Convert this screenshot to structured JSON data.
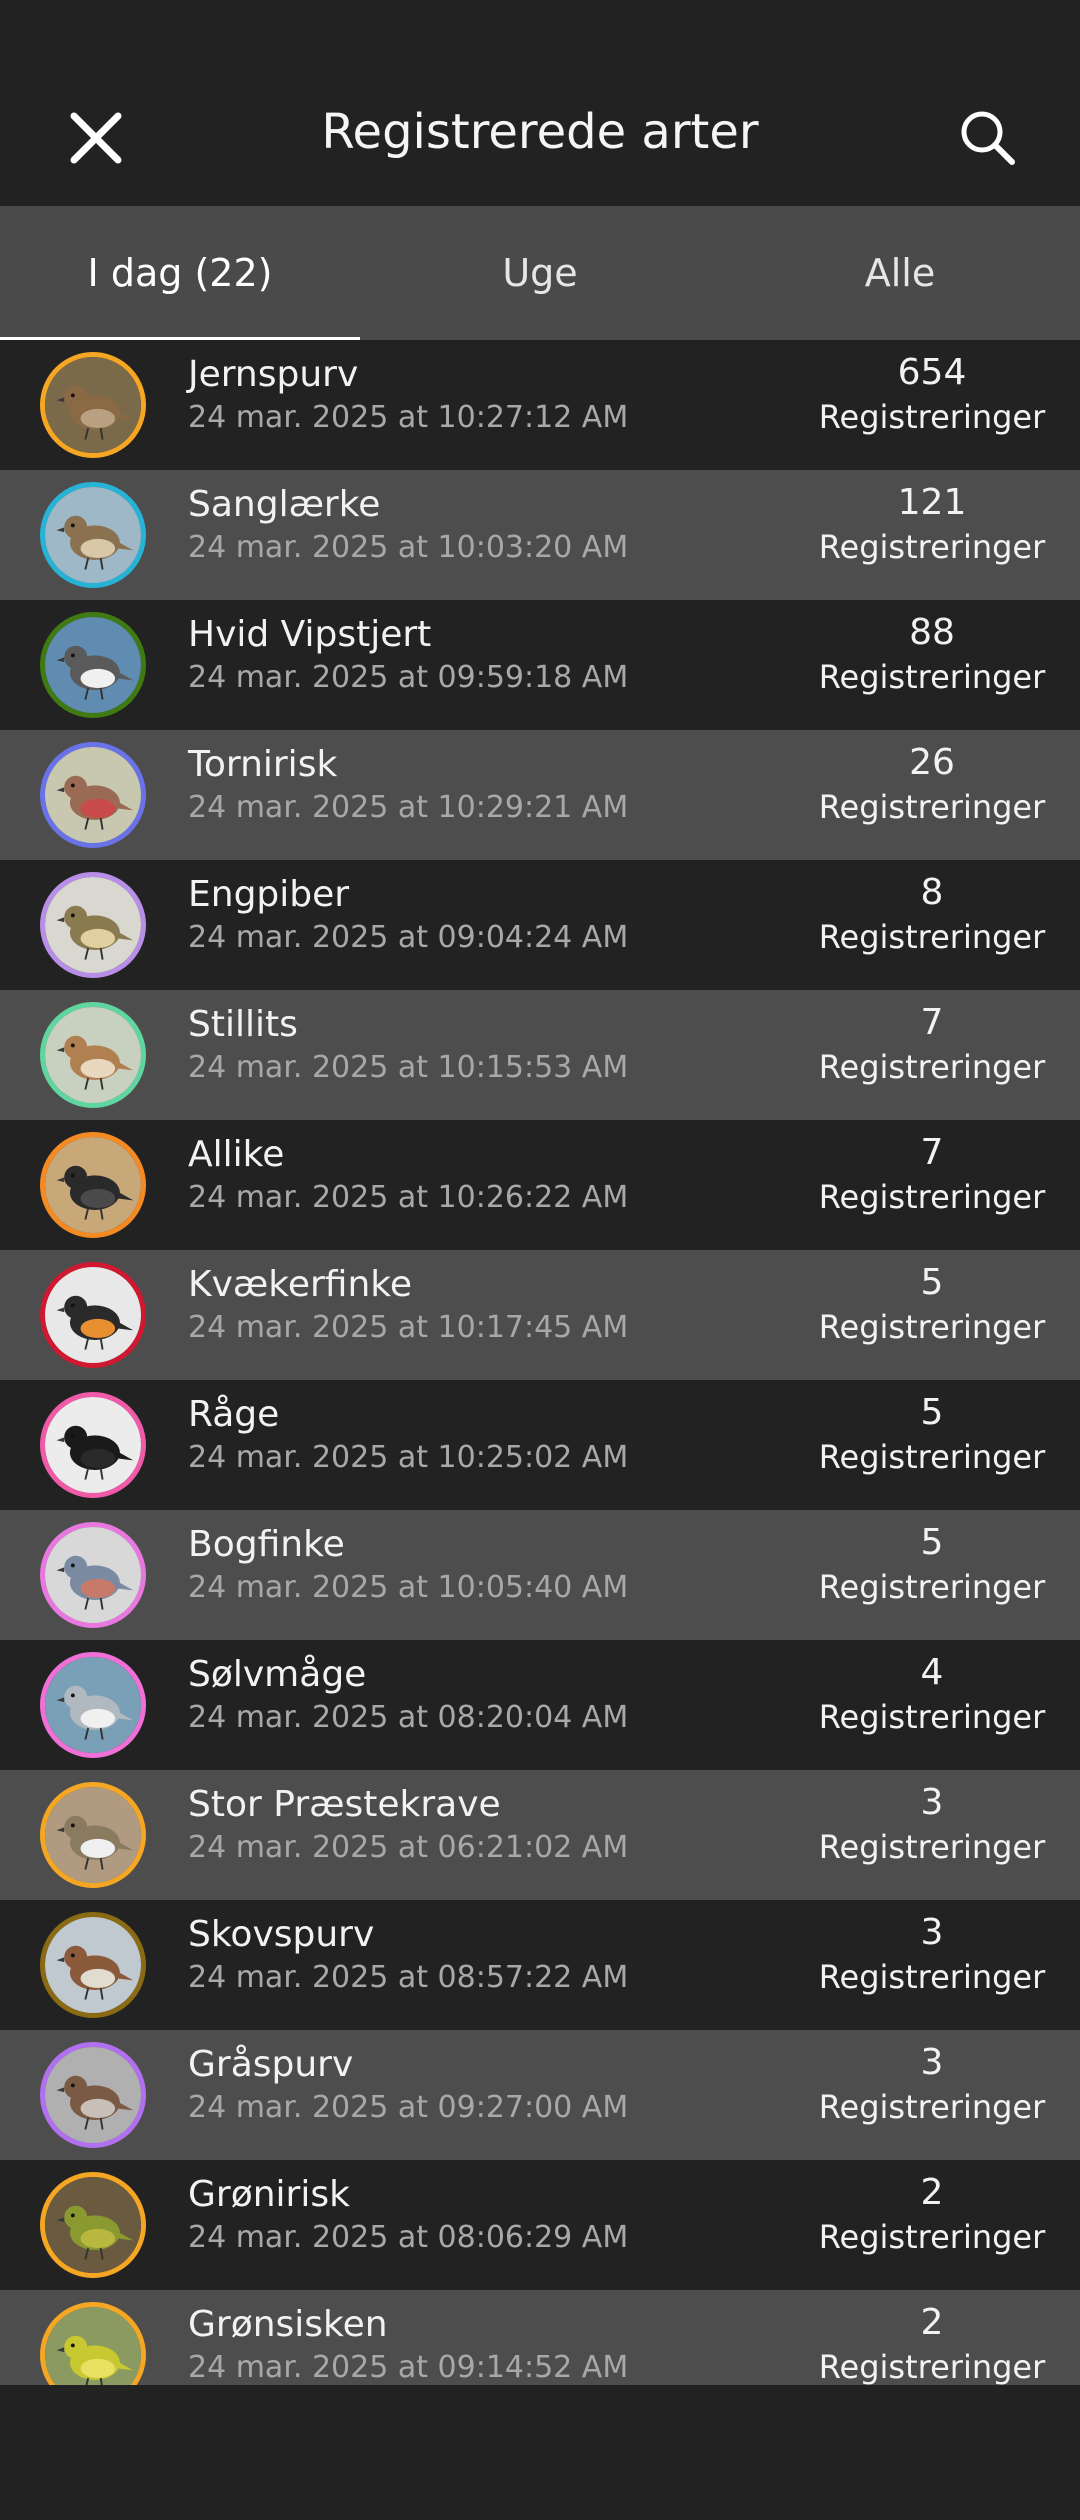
{
  "header": {
    "title": "Registrerede arter",
    "close_icon": "close-icon",
    "search_icon": "search-icon"
  },
  "tabs": [
    {
      "label": "I dag (22)",
      "active": true
    },
    {
      "label": "Uge",
      "active": false
    },
    {
      "label": "Alle",
      "active": false
    }
  ],
  "count_label": "Registreringer",
  "species": [
    {
      "name": "Jernspurv",
      "time": "24 mar. 2025 at 10:27:12 AM",
      "count": "654",
      "ring": "#f5a623",
      "bg": "#7a6a4a",
      "bird": "#8a6a45",
      "belly": "#b8a080"
    },
    {
      "name": "Sanglærke",
      "time": "24 mar. 2025 at 10:03:20 AM",
      "count": "121",
      "ring": "#27b3d6",
      "bg": "#9fb8c8",
      "bird": "#8a7150",
      "belly": "#d8c8a8"
    },
    {
      "name": "Hvid Vipstjert",
      "time": "24 mar. 2025 at 09:59:18 AM",
      "count": "88",
      "ring": "#3f7a12",
      "bg": "#5f8cb0",
      "bird": "#5a5a5a",
      "belly": "#f0f0f0"
    },
    {
      "name": "Tornirisk",
      "time": "24 mar. 2025 at 10:29:21 AM",
      "count": "26",
      "ring": "#6a72e8",
      "bg": "#c8c8b0",
      "bird": "#9a6a55",
      "belly": "#c84a4a"
    },
    {
      "name": "Engpiber",
      "time": "24 mar. 2025 at 09:04:24 AM",
      "count": "8",
      "ring": "#b88ee8",
      "bg": "#d8d8d0",
      "bird": "#8a7a50",
      "belly": "#e0d0a0"
    },
    {
      "name": "Stillits",
      "time": "24 mar. 2025 at 10:15:53 AM",
      "count": "7",
      "ring": "#5fd6a0",
      "bg": "#c8d0c0",
      "bird": "#b08050",
      "belly": "#e8d8c0"
    },
    {
      "name": "Allike",
      "time": "24 mar. 2025 at 10:26:22 AM",
      "count": "7",
      "ring": "#f58a23",
      "bg": "#c8a878",
      "bird": "#2a2a2a",
      "belly": "#4a4a4a"
    },
    {
      "name": "Kvækerfinke",
      "time": "24 mar. 2025 at 10:17:45 AM",
      "count": "5",
      "ring": "#d01830",
      "bg": "#e8e8e8",
      "bird": "#2a2a2a",
      "belly": "#e89030"
    },
    {
      "name": "Råge",
      "time": "24 mar. 2025 at 10:25:02 AM",
      "count": "5",
      "ring": "#f05aa8",
      "bg": "#ececec",
      "bird": "#1a1a1a",
      "belly": "#2a2a2a"
    },
    {
      "name": "Bogfinke",
      "time": "24 mar. 2025 at 10:05:40 AM",
      "count": "5",
      "ring": "#e878e0",
      "bg": "#d8d8d8",
      "bird": "#7a8aa0",
      "belly": "#c87a6a"
    },
    {
      "name": "Sølvmåge",
      "time": "24 mar. 2025 at 08:20:04 AM",
      "count": "4",
      "ring": "#f070d8",
      "bg": "#7aa0b8",
      "bird": "#b0b8c0",
      "belly": "#f0f0f0"
    },
    {
      "name": "Stor Præstekrave",
      "time": "24 mar. 2025 at 06:21:02 AM",
      "count": "3",
      "ring": "#f5a623",
      "bg": "#b09a80",
      "bird": "#8a7a60",
      "belly": "#f0f0f0"
    },
    {
      "name": "Skovspurv",
      "time": "24 mar. 2025 at 08:57:22 AM",
      "count": "3",
      "ring": "#8a6a12",
      "bg": "#c0c8d0",
      "bird": "#8a5a3a",
      "belly": "#e0dcd0"
    },
    {
      "name": "Gråspurv",
      "time": "24 mar. 2025 at 09:27:00 AM",
      "count": "3",
      "ring": "#b070f0",
      "bg": "#b0b0b0",
      "bird": "#7a5a45",
      "belly": "#c8c0b8"
    },
    {
      "name": "Grønirisk",
      "time": "24 mar. 2025 at 08:06:29 AM",
      "count": "2",
      "ring": "#f5a623",
      "bg": "#6a5a40",
      "bird": "#8a9a30",
      "belly": "#b8b840"
    },
    {
      "name": "Grønsisken",
      "time": "24 mar. 2025 at 09:14:52 AM",
      "count": "2",
      "ring": "#f5a623",
      "bg": "#8a9a60",
      "bird": "#c8c830",
      "belly": "#e8e060"
    }
  ]
}
